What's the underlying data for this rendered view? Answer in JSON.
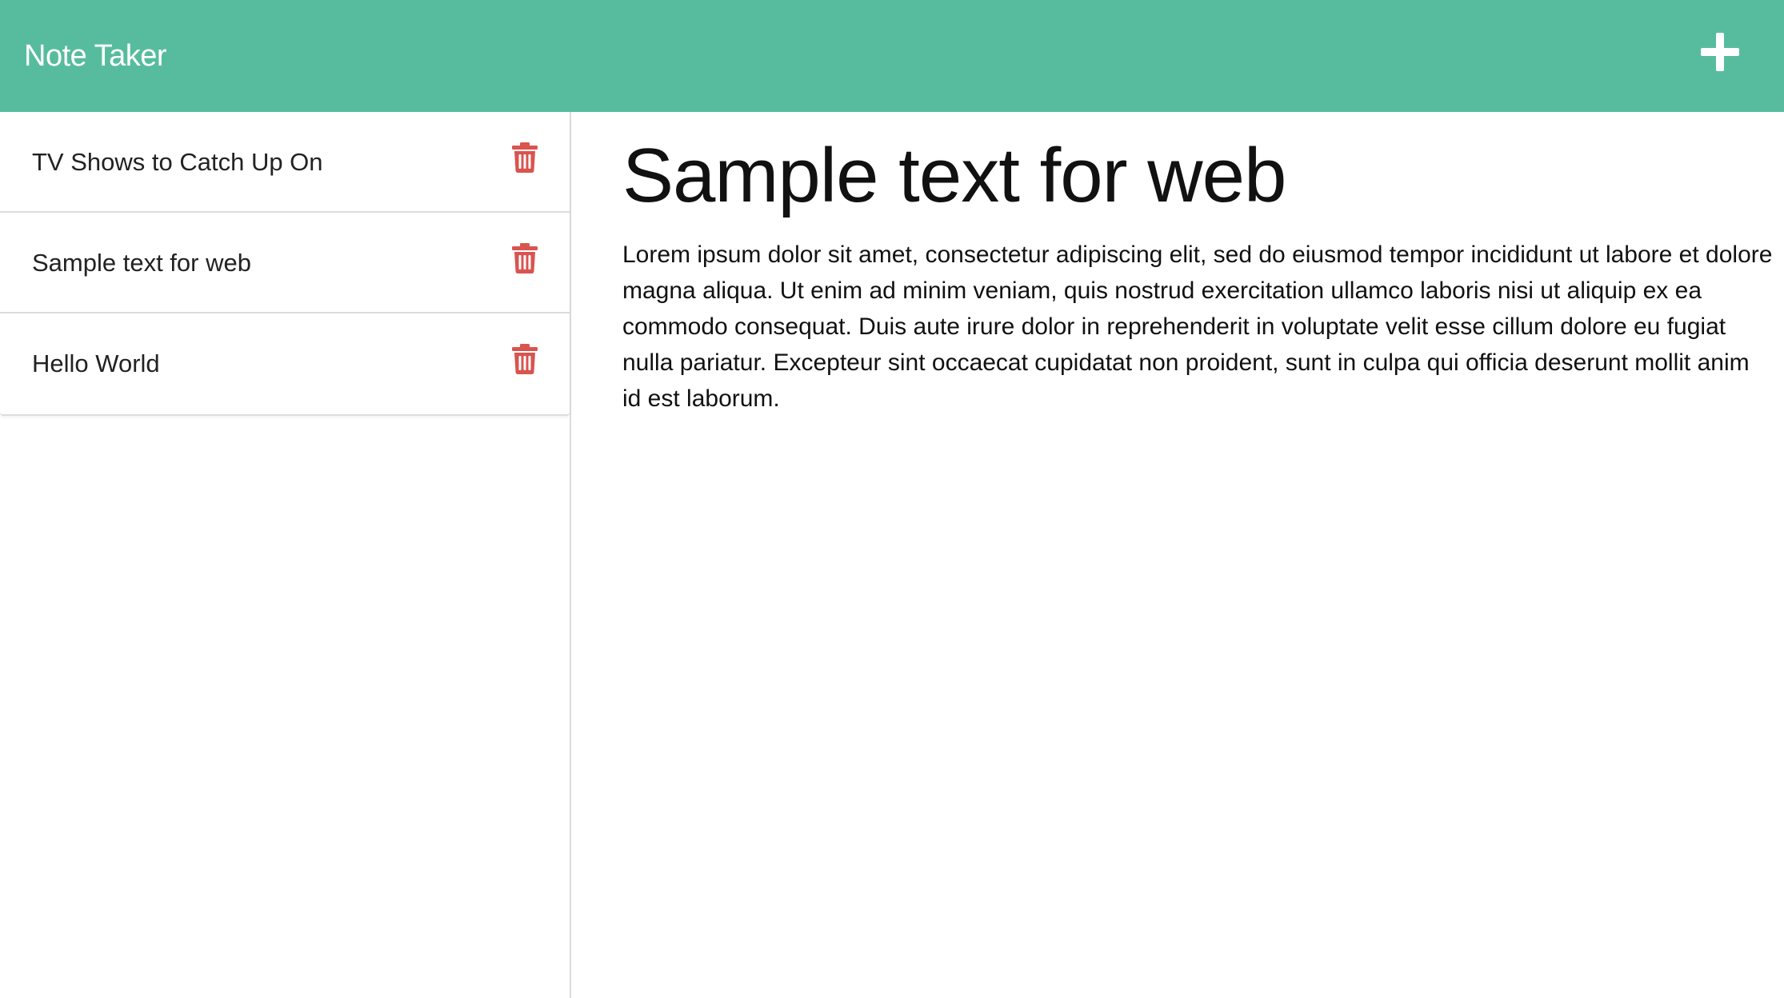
{
  "app": {
    "title": "Note Taker",
    "accent_color": "#57bc9e",
    "delete_color": "#d9544f"
  },
  "header": {
    "brand": "Note Taker",
    "add_icon": "plus-icon"
  },
  "sidebar": {
    "notes": [
      {
        "title": "TV Shows to Catch Up On",
        "icon": "trash-icon"
      },
      {
        "title": "Sample text for web",
        "icon": "trash-icon"
      },
      {
        "title": "Hello World",
        "icon": "trash-icon"
      }
    ]
  },
  "main": {
    "note_title": "Sample text for web",
    "note_text": "Lorem ipsum dolor sit amet, consectetur adipiscing elit, sed do eiusmod tempor incididunt ut labore et dolore magna aliqua. Ut enim ad minim veniam, quis nostrud exercitation ullamco laboris nisi ut aliquip ex ea commodo consequat. Duis aute irure dolor in reprehenderit in voluptate velit esse cillum dolore eu fugiat nulla pariatur. Excepteur sint occaecat cupidatat non proident, sunt in culpa qui officia deserunt mollit anim id est laborum."
  }
}
